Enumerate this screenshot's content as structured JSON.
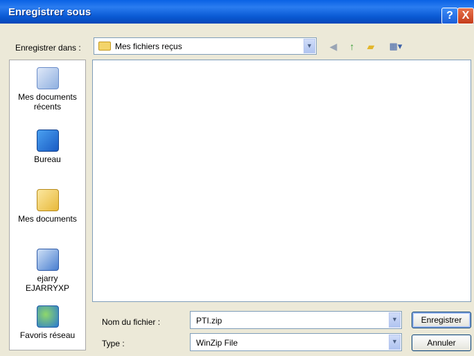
{
  "window": {
    "title": "Enregistrer sous",
    "help_glyph": "?",
    "close_glyph": "X"
  },
  "lookin": {
    "label": "Enregistrer dans :",
    "value": "Mes fichiers reçus"
  },
  "toolbar": {
    "back_icon": "back-icon",
    "up_icon": "up-folder-icon",
    "newfolder_icon": "new-folder-icon",
    "views_icon": "views-menu-icon"
  },
  "places": [
    {
      "label": "Mes documents récents",
      "icon": "recent-documents-icon"
    },
    {
      "label": "Bureau",
      "icon": "desktop-icon"
    },
    {
      "label": "Mes documents",
      "icon": "my-documents-icon"
    },
    {
      "label": "ejarry EJARRYXP",
      "icon": "my-computer-icon"
    },
    {
      "label": "Favoris réseau",
      "icon": "network-places-icon"
    }
  ],
  "filename": {
    "label": "Nom du fichier :",
    "value": "PTI.zip"
  },
  "filetype": {
    "label": "Type :",
    "value": "WinZip File"
  },
  "buttons": {
    "save": "Enregistrer",
    "cancel": "Annuler"
  },
  "colors": {
    "titlebar": "#0a5ad4",
    "dialog_bg": "#ece9d8",
    "close": "#c43c1a"
  }
}
